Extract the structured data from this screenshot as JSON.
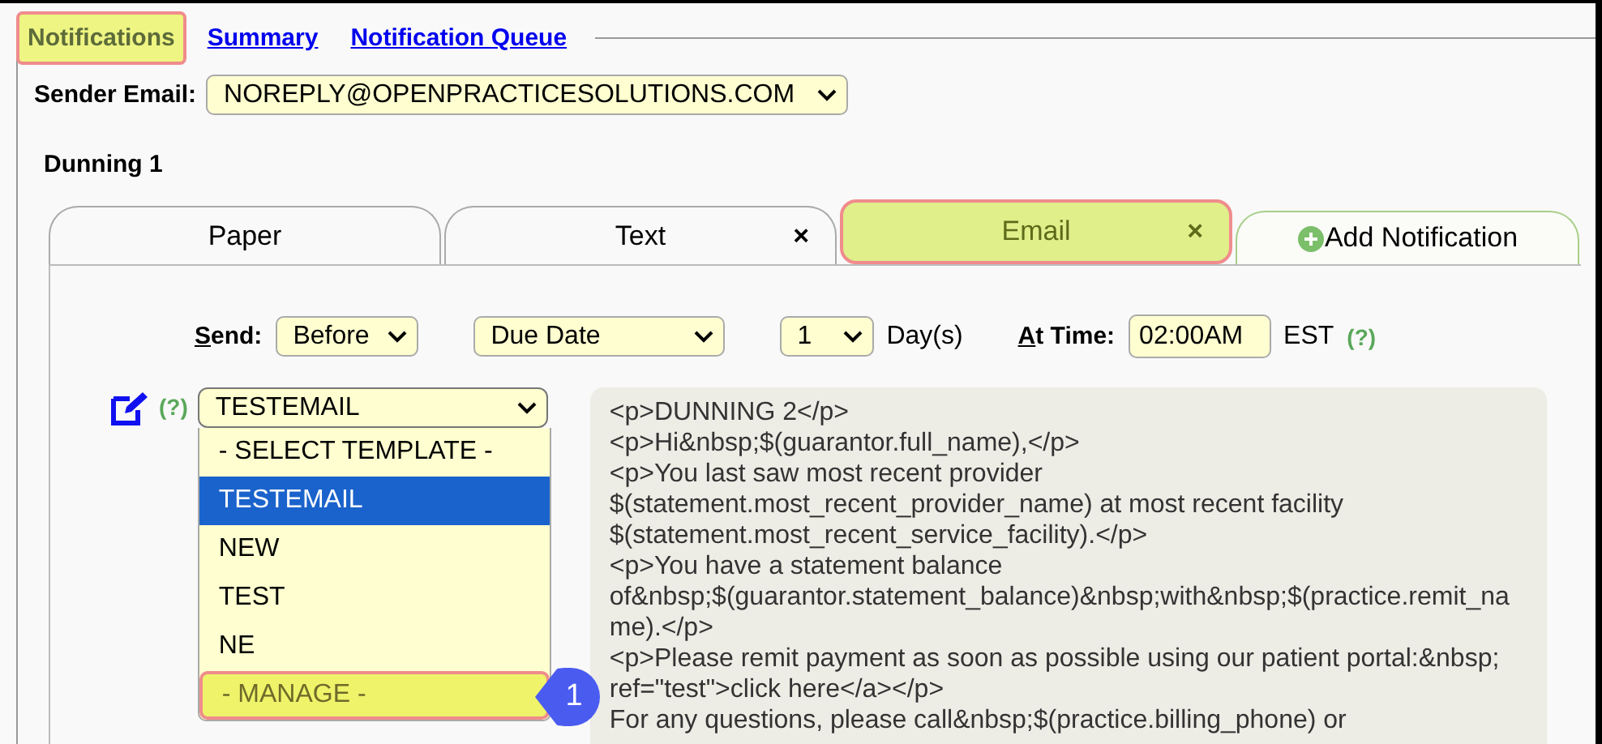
{
  "nav_tabs": [
    {
      "label": "Notifications",
      "selected": true,
      "highlighted": true
    },
    {
      "label": "Summary",
      "selected": false,
      "highlighted": false
    },
    {
      "label": "Notification Queue",
      "selected": false,
      "highlighted": false
    }
  ],
  "sender": {
    "label": "Sender Email:",
    "value": "NOREPLY@OPENPRACTICESOLUTIONS.COM"
  },
  "section_title": "Dunning 1",
  "notification_tabs": [
    {
      "label": "Paper",
      "selected": false,
      "highlighted": false
    },
    {
      "label": "Text",
      "selected": false,
      "highlighted": false,
      "close": "×"
    },
    {
      "label": "Email",
      "selected": true,
      "highlighted": true,
      "close": "×"
    }
  ],
  "add_tab": {
    "label": "Add Notification"
  },
  "send_row": {
    "send_label": "Send:",
    "timing": "Before",
    "event": "Due Date",
    "count": "1",
    "unit": "Day(s)",
    "time_label": "At Time:",
    "time": "02:00AM",
    "timezone": "EST",
    "help": "(?)"
  },
  "template": {
    "help": "(?)",
    "value": "TESTEMAIL",
    "options": [
      {
        "label": "- SELECT TEMPLATE -",
        "selected": false,
        "highlighted": false
      },
      {
        "label": "TESTEMAIL",
        "selected": true,
        "highlighted": false
      },
      {
        "label": "NEW",
        "selected": false,
        "highlighted": false
      },
      {
        "label": "TEST",
        "selected": false,
        "highlighted": false
      },
      {
        "label": "NE",
        "selected": false,
        "highlighted": false
      },
      {
        "label": "- MANAGE -",
        "selected": false,
        "highlighted": true
      }
    ]
  },
  "body_lines": [
    "<p>DUNNING 2</p>",
    "<p>Hi&nbsp;$(guarantor.full_name),</p>",
    "<p>You last saw most recent provider",
    "$(statement.most_recent_provider_name) at most recent facility",
    "$(statement.most_recent_service_facility).</p>",
    "<p>You have a statement balance",
    "of&nbsp;$(guarantor.statement_balance)&nbsp;with&nbsp;$(practice.remit_na",
    "me).</p>",
    "<p>Please remit payment as soon as possible using our patient portal:&nbsp;",
    "ref=\"test\">click here</a></p>",
    "For any questions, please call&nbsp;$(practice.billing_phone) or"
  ],
  "callout": "1"
}
